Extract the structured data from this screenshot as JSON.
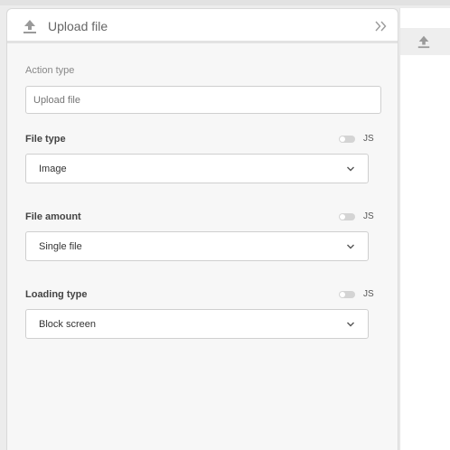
{
  "header": {
    "title": "Upload file",
    "icon": "upload-icon"
  },
  "action_type": {
    "label": "Action type",
    "placeholder": "Upload file"
  },
  "js_label": "JS",
  "fields": [
    {
      "label": "File type",
      "value": "Image"
    },
    {
      "label": "File amount",
      "value": "Single file"
    },
    {
      "label": "Loading type",
      "value": "Block screen"
    }
  ],
  "colors": {
    "icon": "#9a9a9a",
    "panel": "#f7f7f7",
    "border": "#cfcfcf"
  }
}
